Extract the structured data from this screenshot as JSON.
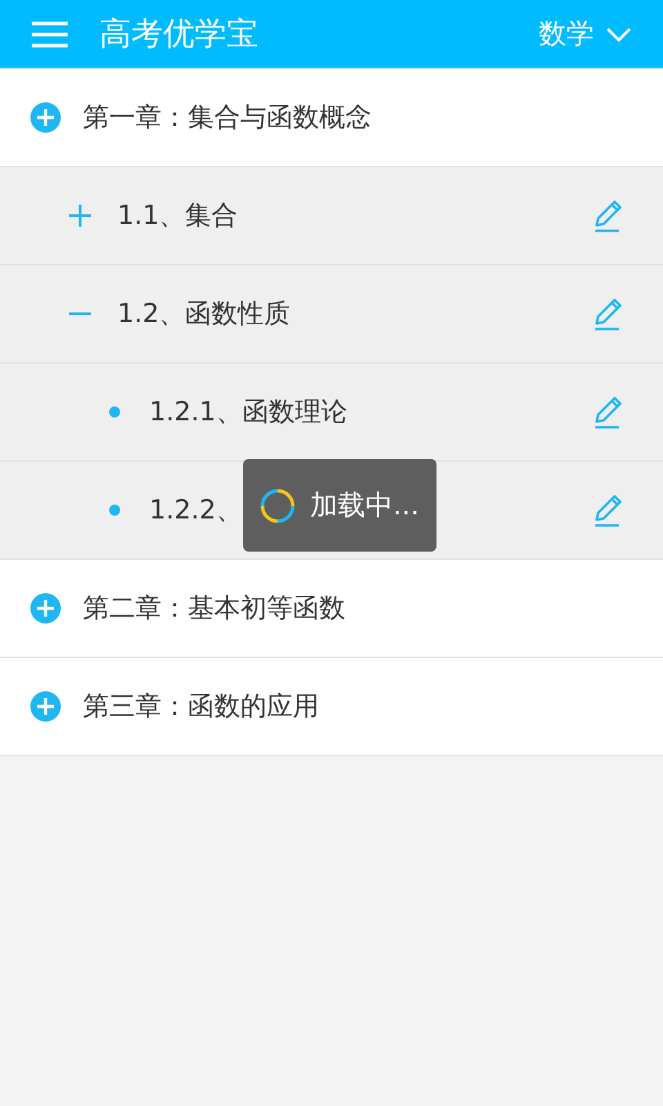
{
  "header": {
    "title": "高考优学宝",
    "subject": "数学"
  },
  "chapters": [
    {
      "title": "第一章：集合与函数概念",
      "children": [
        {
          "title": "1.1、集合",
          "expanded": false
        },
        {
          "title": "1.2、函数性质",
          "expanded": true,
          "children": [
            {
              "title": "1.2.1、函数理论"
            },
            {
              "title": "1.2.2、"
            }
          ]
        }
      ]
    },
    {
      "title": "第二章：基本初等函数"
    },
    {
      "title": "第三章：函数的应用"
    }
  ],
  "toast": {
    "text": "加载中..."
  }
}
